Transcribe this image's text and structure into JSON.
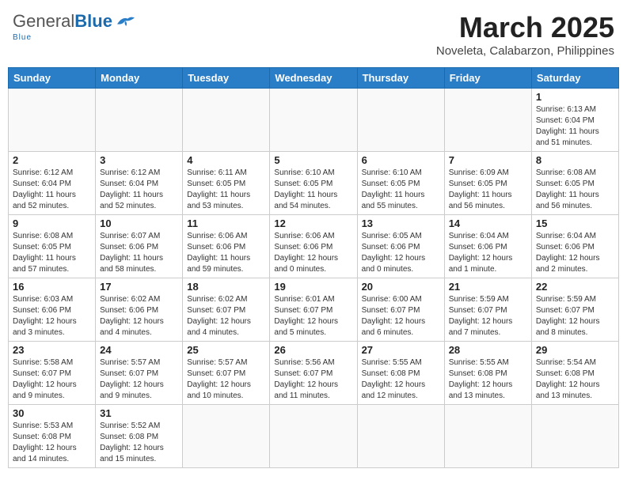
{
  "header": {
    "logo_general": "General",
    "logo_blue": "Blue",
    "logo_sub": "Blue",
    "month_title": "March 2025",
    "location": "Noveleta, Calabarzon, Philippines"
  },
  "weekdays": [
    "Sunday",
    "Monday",
    "Tuesday",
    "Wednesday",
    "Thursday",
    "Friday",
    "Saturday"
  ],
  "weeks": [
    [
      {
        "day": "",
        "info": ""
      },
      {
        "day": "",
        "info": ""
      },
      {
        "day": "",
        "info": ""
      },
      {
        "day": "",
        "info": ""
      },
      {
        "day": "",
        "info": ""
      },
      {
        "day": "",
        "info": ""
      },
      {
        "day": "1",
        "info": "Sunrise: 6:13 AM\nSunset: 6:04 PM\nDaylight: 11 hours\nand 51 minutes."
      }
    ],
    [
      {
        "day": "2",
        "info": "Sunrise: 6:12 AM\nSunset: 6:04 PM\nDaylight: 11 hours\nand 52 minutes."
      },
      {
        "day": "3",
        "info": "Sunrise: 6:12 AM\nSunset: 6:04 PM\nDaylight: 11 hours\nand 52 minutes."
      },
      {
        "day": "4",
        "info": "Sunrise: 6:11 AM\nSunset: 6:05 PM\nDaylight: 11 hours\nand 53 minutes."
      },
      {
        "day": "5",
        "info": "Sunrise: 6:10 AM\nSunset: 6:05 PM\nDaylight: 11 hours\nand 54 minutes."
      },
      {
        "day": "6",
        "info": "Sunrise: 6:10 AM\nSunset: 6:05 PM\nDaylight: 11 hours\nand 55 minutes."
      },
      {
        "day": "7",
        "info": "Sunrise: 6:09 AM\nSunset: 6:05 PM\nDaylight: 11 hours\nand 56 minutes."
      },
      {
        "day": "8",
        "info": "Sunrise: 6:08 AM\nSunset: 6:05 PM\nDaylight: 11 hours\nand 56 minutes."
      }
    ],
    [
      {
        "day": "9",
        "info": "Sunrise: 6:08 AM\nSunset: 6:05 PM\nDaylight: 11 hours\nand 57 minutes."
      },
      {
        "day": "10",
        "info": "Sunrise: 6:07 AM\nSunset: 6:06 PM\nDaylight: 11 hours\nand 58 minutes."
      },
      {
        "day": "11",
        "info": "Sunrise: 6:06 AM\nSunset: 6:06 PM\nDaylight: 11 hours\nand 59 minutes."
      },
      {
        "day": "12",
        "info": "Sunrise: 6:06 AM\nSunset: 6:06 PM\nDaylight: 12 hours\nand 0 minutes."
      },
      {
        "day": "13",
        "info": "Sunrise: 6:05 AM\nSunset: 6:06 PM\nDaylight: 12 hours\nand 0 minutes."
      },
      {
        "day": "14",
        "info": "Sunrise: 6:04 AM\nSunset: 6:06 PM\nDaylight: 12 hours\nand 1 minute."
      },
      {
        "day": "15",
        "info": "Sunrise: 6:04 AM\nSunset: 6:06 PM\nDaylight: 12 hours\nand 2 minutes."
      }
    ],
    [
      {
        "day": "16",
        "info": "Sunrise: 6:03 AM\nSunset: 6:06 PM\nDaylight: 12 hours\nand 3 minutes."
      },
      {
        "day": "17",
        "info": "Sunrise: 6:02 AM\nSunset: 6:06 PM\nDaylight: 12 hours\nand 4 minutes."
      },
      {
        "day": "18",
        "info": "Sunrise: 6:02 AM\nSunset: 6:07 PM\nDaylight: 12 hours\nand 4 minutes."
      },
      {
        "day": "19",
        "info": "Sunrise: 6:01 AM\nSunset: 6:07 PM\nDaylight: 12 hours\nand 5 minutes."
      },
      {
        "day": "20",
        "info": "Sunrise: 6:00 AM\nSunset: 6:07 PM\nDaylight: 12 hours\nand 6 minutes."
      },
      {
        "day": "21",
        "info": "Sunrise: 5:59 AM\nSunset: 6:07 PM\nDaylight: 12 hours\nand 7 minutes."
      },
      {
        "day": "22",
        "info": "Sunrise: 5:59 AM\nSunset: 6:07 PM\nDaylight: 12 hours\nand 8 minutes."
      }
    ],
    [
      {
        "day": "23",
        "info": "Sunrise: 5:58 AM\nSunset: 6:07 PM\nDaylight: 12 hours\nand 9 minutes."
      },
      {
        "day": "24",
        "info": "Sunrise: 5:57 AM\nSunset: 6:07 PM\nDaylight: 12 hours\nand 9 minutes."
      },
      {
        "day": "25",
        "info": "Sunrise: 5:57 AM\nSunset: 6:07 PM\nDaylight: 12 hours\nand 10 minutes."
      },
      {
        "day": "26",
        "info": "Sunrise: 5:56 AM\nSunset: 6:07 PM\nDaylight: 12 hours\nand 11 minutes."
      },
      {
        "day": "27",
        "info": "Sunrise: 5:55 AM\nSunset: 6:08 PM\nDaylight: 12 hours\nand 12 minutes."
      },
      {
        "day": "28",
        "info": "Sunrise: 5:55 AM\nSunset: 6:08 PM\nDaylight: 12 hours\nand 13 minutes."
      },
      {
        "day": "29",
        "info": "Sunrise: 5:54 AM\nSunset: 6:08 PM\nDaylight: 12 hours\nand 13 minutes."
      }
    ],
    [
      {
        "day": "30",
        "info": "Sunrise: 5:53 AM\nSunset: 6:08 PM\nDaylight: 12 hours\nand 14 minutes."
      },
      {
        "day": "31",
        "info": "Sunrise: 5:52 AM\nSunset: 6:08 PM\nDaylight: 12 hours\nand 15 minutes."
      },
      {
        "day": "",
        "info": ""
      },
      {
        "day": "",
        "info": ""
      },
      {
        "day": "",
        "info": ""
      },
      {
        "day": "",
        "info": ""
      },
      {
        "day": "",
        "info": ""
      }
    ]
  ]
}
